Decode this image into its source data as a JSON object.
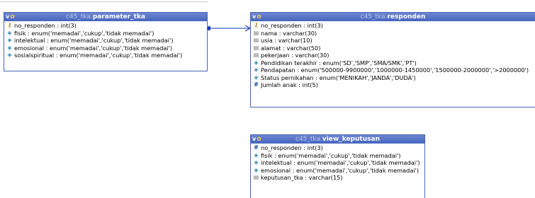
{
  "tables": [
    {
      "db": "c45_tka.",
      "name": "parameter_tka",
      "fields": [
        {
          "icon": "key-icon",
          "text": "no_responden : int(3)"
        },
        {
          "icon": "enum-icon",
          "text": "fisik : enum('memadai','cukup','tidak memadai')"
        },
        {
          "icon": "enum-icon",
          "text": "intelektual : enum('memadai','cukup','tidak memadai')"
        },
        {
          "icon": "enum-icon",
          "text": "emosional : enum('memadai','cukup','tidak memadai')"
        },
        {
          "icon": "enum-icon",
          "text": "sosialspiritual : enum('memadai','cukup','tidak memadai')"
        }
      ]
    },
    {
      "db": "c45_tka.",
      "name": "responden",
      "fields": [
        {
          "icon": "key-icon",
          "text": "no_responden : int(3)"
        },
        {
          "icon": "string-icon",
          "text": "nama : varchar(30)"
        },
        {
          "icon": "string-icon",
          "text": "usia : varchar(10)"
        },
        {
          "icon": "string-icon",
          "text": "alamat : varchar(50)"
        },
        {
          "icon": "string-icon",
          "text": "pekerjaan : varchar(30)"
        },
        {
          "icon": "enum-icon",
          "text": "Pendidikan terakhir : enum('SD','SMP','SMA/SMK','PT')"
        },
        {
          "icon": "enum-icon",
          "text": "Pendapatan : enum('500000-9900000','1000000-1450000','1500000-2000000','>2000000')"
        },
        {
          "icon": "enum-icon",
          "text": "Status pernikahan : enum('MENIKAH','JANDA','DUDA')"
        },
        {
          "icon": "number-icon",
          "text": "Jumlah anak : int(5)"
        }
      ]
    },
    {
      "db": "c45_tka.",
      "name": "view_keputusan",
      "fields": [
        {
          "icon": "number-icon",
          "text": "no_responden : int(3)"
        },
        {
          "icon": "enum-icon",
          "text": "fisik : enum('memadai','cukup','tidak memadai')"
        },
        {
          "icon": "enum-icon",
          "text": "intelektual : enum('memadai','cukup','tidak memadai')"
        },
        {
          "icon": "enum-icon",
          "text": "emosional : enum('memadai','cukup','tidak memadai')"
        },
        {
          "icon": "string-icon",
          "text": "keputusan_tka : varchar(15)"
        }
      ]
    }
  ]
}
